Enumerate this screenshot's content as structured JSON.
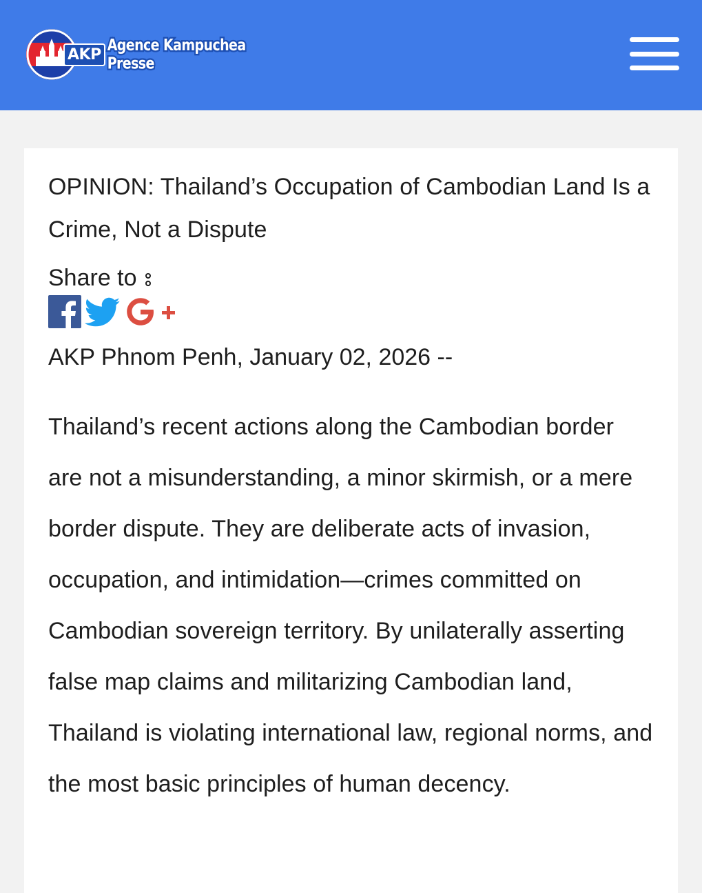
{
  "site": {
    "logo_abbr": "AKP",
    "logo_name": "Agence Kampuchea Presse"
  },
  "colors": {
    "header_bg": "#3f7be8",
    "facebook": "#3b5998",
    "twitter": "#1da1f2",
    "google_plus": "#dc4e41"
  },
  "icons": {
    "menu": "hamburger-icon",
    "share_more": "more-vertical-icon",
    "facebook": "facebook-icon",
    "twitter": "twitter-icon",
    "google_plus": "google-plus-icon"
  },
  "article": {
    "headline": "OPINION: Thailand’s Occupation of Cambodian Land Is a Crime, Not a Dispute",
    "share_label": "Share to",
    "dateline": "AKP Phnom Penh, January 02, 2026 --",
    "body": "Thailand’s recent actions along the Cambodian border are not a misunderstanding, a minor skirmish, or a mere border dispute. They are deliberate acts of invasion, occupation, and intimidation—crimes committed on Cambodian sovereign territory. By unilaterally asserting false map claims and militarizing Cambodian land, Thailand is violating international law, regional norms, and the most basic principles of human decency."
  }
}
